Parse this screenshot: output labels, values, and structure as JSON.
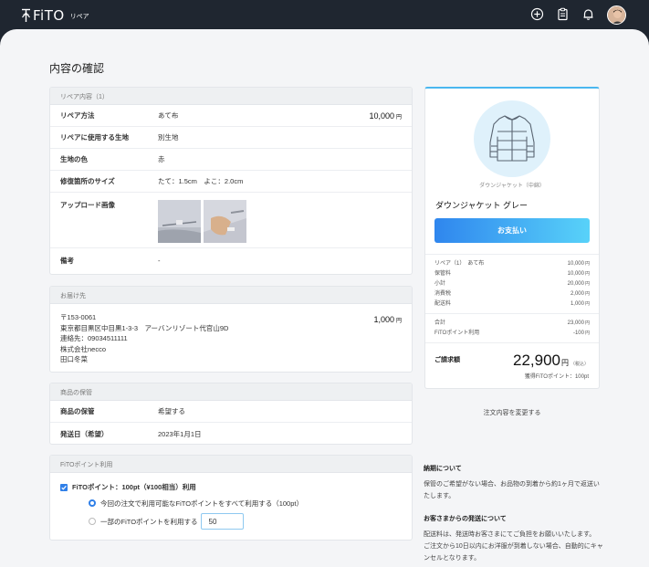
{
  "header": {
    "logo": "FiTO",
    "subtitle": "リペア",
    "icons": [
      "plus-circle-icon",
      "clipboard-icon",
      "bell-icon",
      "avatar"
    ]
  },
  "page": {
    "title": "内容の確認"
  },
  "repair": {
    "section_title": "リペア内容（1）",
    "method_label": "リペア方法",
    "method_value": "あて布",
    "method_price": "10,000",
    "fabric_label": "リペアに使用する生地",
    "fabric_value": "別生地",
    "color_label": "生地の色",
    "color_value": "赤",
    "size_label": "修復箇所のサイズ",
    "size_value": "たて：1.5cm　よこ：2.0cm",
    "upload_label": "アップロード画像",
    "note_label": "備考",
    "note_value": "-",
    "yen": "円"
  },
  "shipping": {
    "section_title": "お届け先",
    "postal": "〒153-0061",
    "address": "東京都目黒区中目黒1-3-3　アーバンリゾート代官山9D",
    "phone": "連絡先：09034511111",
    "company": "株式会社necco",
    "name": "田口冬菜",
    "price": "1,000",
    "yen": "円"
  },
  "storage": {
    "section_title": "商品の保管",
    "storage_label": "商品の保管",
    "storage_value": "希望する",
    "date_label": "発送日（希望）",
    "date_value": "2023年1月1日"
  },
  "points": {
    "section_title": "FiTOポイント利用",
    "use_label": "FiTOポイント：100pt（¥100相当）利用",
    "option_all": "今回の注文で利用可能なFiTOポイントをすべて利用する（100pt）",
    "option_partial": "一部のFiTOポイントを利用する",
    "partial_value": "50"
  },
  "summary": {
    "category": "ダウンジャケット（中綿）",
    "product_name": "ダウンジャケット グレー",
    "pay_button": "お支払い",
    "lines": [
      {
        "label": "リペア（1）　あて布",
        "amount": "10,000"
      },
      {
        "label": "保管料",
        "amount": "10,000"
      },
      {
        "label": "小計",
        "amount": "20,000"
      },
      {
        "label": "消費税",
        "amount": "2,000"
      },
      {
        "label": "配送料",
        "amount": "1,000"
      }
    ],
    "lines2": [
      {
        "label": "合計",
        "amount": "23,000"
      },
      {
        "label": "FiTOポイント利用",
        "amount": "-100"
      }
    ],
    "yen": "円",
    "total_label": "ご請求額",
    "total_amount": "22,900",
    "total_yen": "円",
    "total_tax": "（税込）",
    "earn_points": "獲得FiTOポイント：100pt"
  },
  "change_link": "注文内容を変更する",
  "notes": {
    "delivery_title": "納期について",
    "delivery_text": "保管のご希望がない場合、お品物の到着から約1ヶ月で返送いたします。",
    "shipping_title": "お客さまからの発送について",
    "shipping_text1": "配送料は、発送時お客さまにてご負担をお願いいたします。",
    "shipping_text2": "ご注文から10日以内にお洋服が到着しない場合、自動的にキャンセルとなります。"
  }
}
